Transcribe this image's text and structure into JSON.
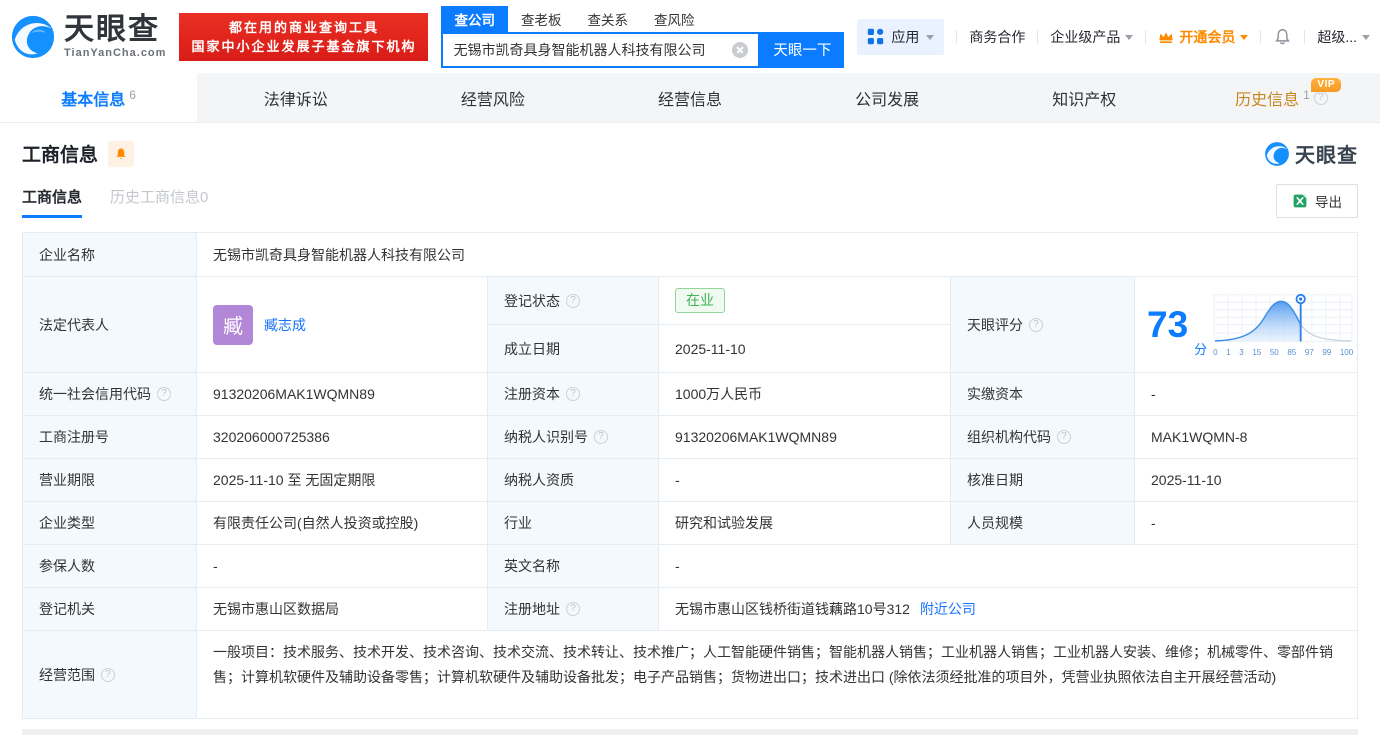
{
  "header": {
    "logo_title": "天眼查",
    "logo_sub": "TianYanCha.com",
    "banner_line1": "都在用的商业查询工具",
    "banner_line2": "国家中小企业发展子基金旗下机构",
    "search_tabs": [
      {
        "label": "查公司"
      },
      {
        "label": "查老板"
      },
      {
        "label": "查关系"
      },
      {
        "label": "查风险"
      }
    ],
    "search_value": "无锡市凯奇具身智能机器人科技有限公司",
    "search_button": "天眼一下",
    "nav_apps": "应用",
    "nav_biz": "商务合作",
    "nav_enterprise": "企业级产品",
    "nav_vip": "开通会员",
    "nav_super": "超级..."
  },
  "tabs": [
    {
      "label": "基本信息",
      "count": "6"
    },
    {
      "label": "法律诉讼"
    },
    {
      "label": "经营风险"
    },
    {
      "label": "经营信息"
    },
    {
      "label": "公司发展"
    },
    {
      "label": "知识产权"
    },
    {
      "label": "历史信息",
      "count": "1",
      "vip_badge": "VIP"
    }
  ],
  "section": {
    "title": "工商信息",
    "watermark": "天眼查",
    "subtab_active": "工商信息",
    "subtab_inactive": "历史工商信息0",
    "export_label": "导出"
  },
  "table": {
    "row1": {
      "label": "企业名称",
      "value": "无锡市凯奇具身智能机器人科技有限公司"
    },
    "row2": {
      "label": "法定代表人",
      "avatar_char": "臧",
      "person": "臧志成",
      "status_label": "登记状态",
      "status_value": "在业",
      "date_label": "成立日期",
      "date_value": "2025-11-10",
      "score_label": "天眼评分",
      "score_value": "73",
      "score_unit": "分"
    },
    "row3": {
      "l1": "统一社会信用代码",
      "v1": "91320206MAK1WQMN89",
      "l2": "注册资本",
      "v2": "1000万人民币",
      "l3": "实缴资本",
      "v3": "-"
    },
    "row4": {
      "l1": "工商注册号",
      "v1": "320206000725386",
      "l2": "纳税人识别号",
      "v2": "91320206MAK1WQMN89",
      "l3": "组织机构代码",
      "v3": "MAK1WQMN-8"
    },
    "row5": {
      "l1": "营业期限",
      "v1": "2025-11-10 至 无固定期限",
      "l2": "纳税人资质",
      "v2": "-",
      "l3": "核准日期",
      "v3": "2025-11-10"
    },
    "row6": {
      "l1": "企业类型",
      "v1": "有限责任公司(自然人投资或控股)",
      "l2": "行业",
      "v2": "研究和试验发展",
      "l3": "人员规模",
      "v3": "-"
    },
    "row7": {
      "l1": "参保人数",
      "v1": "-",
      "l2": "英文名称",
      "v2": "-"
    },
    "row8": {
      "l1": "登记机关",
      "v1": "无锡市惠山区数据局",
      "l2": "注册地址",
      "v2": "无锡市惠山区钱桥街道钱藕路10号312",
      "v2_link": "附近公司"
    },
    "row9": {
      "label": "经营范围",
      "value": "一般项目：技术服务、技术开发、技术咨询、技术交流、技术转让、技术推广；人工智能硬件销售；智能机器人销售；工业机器人销售；工业机器人安装、维修；机械零件、零部件销售；计算机软硬件及辅助设备零售；计算机软硬件及辅助设备批发；电子产品销售；货物进出口；技术进出口 (除依法须经批准的项目外，凭营业执照依法自主开展经营活动)"
    }
  },
  "chart_data": {
    "type": "area",
    "title": "天眼评分分布曲线",
    "score": 73,
    "score_display": "73分",
    "x_ticks": [
      "0",
      "1",
      "3",
      "15",
      "50",
      "85",
      "97",
      "99",
      "100"
    ],
    "marker_value": 73,
    "curve": "normal-distribution, blue filled left of marker, gray right"
  },
  "colors": {
    "primary_blue": "#0b7cff",
    "banner_red": "#e2211c",
    "vip_orange": "#ff8a00",
    "status_green": "#3eb155",
    "history_tab_amber": "#c9861f",
    "label_cell_bg": "#f3f9fd"
  }
}
